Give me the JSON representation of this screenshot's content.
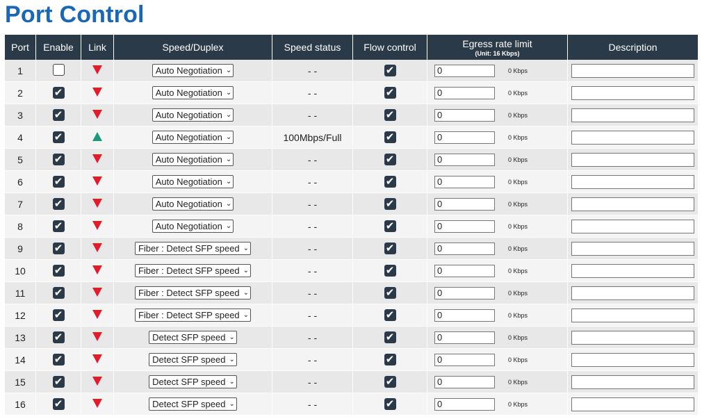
{
  "page": {
    "title": "Port Control"
  },
  "headers": {
    "port": "Port",
    "enable": "Enable",
    "link": "Link",
    "speed_duplex": "Speed/Duplex",
    "speed_status": "Speed status",
    "flow_control": "Flow control",
    "egress": "Egress rate limit",
    "egress_unit": "(Unit: 16 Kbps)",
    "description": "Description"
  },
  "rows": [
    {
      "port": "1",
      "enable": false,
      "link": "down",
      "speed": "Auto Negotiation",
      "status": "- -",
      "flow": true,
      "egress": "0",
      "unit": "0 Kbps",
      "desc": ""
    },
    {
      "port": "2",
      "enable": true,
      "link": "down",
      "speed": "Auto Negotiation",
      "status": "- -",
      "flow": true,
      "egress": "0",
      "unit": "0 Kbps",
      "desc": ""
    },
    {
      "port": "3",
      "enable": true,
      "link": "down",
      "speed": "Auto Negotiation",
      "status": "- -",
      "flow": true,
      "egress": "0",
      "unit": "0 Kbps",
      "desc": ""
    },
    {
      "port": "4",
      "enable": true,
      "link": "up",
      "speed": "Auto Negotiation",
      "status": "100Mbps/Full",
      "flow": true,
      "egress": "0",
      "unit": "0 Kbps",
      "desc": ""
    },
    {
      "port": "5",
      "enable": true,
      "link": "down",
      "speed": "Auto Negotiation",
      "status": "- -",
      "flow": true,
      "egress": "0",
      "unit": "0 Kbps",
      "desc": ""
    },
    {
      "port": "6",
      "enable": true,
      "link": "down",
      "speed": "Auto Negotiation",
      "status": "- -",
      "flow": true,
      "egress": "0",
      "unit": "0 Kbps",
      "desc": ""
    },
    {
      "port": "7",
      "enable": true,
      "link": "down",
      "speed": "Auto Negotiation",
      "status": "- -",
      "flow": true,
      "egress": "0",
      "unit": "0 Kbps",
      "desc": ""
    },
    {
      "port": "8",
      "enable": true,
      "link": "down",
      "speed": "Auto Negotiation",
      "status": "- -",
      "flow": true,
      "egress": "0",
      "unit": "0 Kbps",
      "desc": ""
    },
    {
      "port": "9",
      "enable": true,
      "link": "down",
      "speed": "Fiber : Detect SFP speed",
      "status": "- -",
      "flow": true,
      "egress": "0",
      "unit": "0 Kbps",
      "desc": ""
    },
    {
      "port": "10",
      "enable": true,
      "link": "down",
      "speed": "Fiber : Detect SFP speed",
      "status": "- -",
      "flow": true,
      "egress": "0",
      "unit": "0 Kbps",
      "desc": ""
    },
    {
      "port": "11",
      "enable": true,
      "link": "down",
      "speed": "Fiber : Detect SFP speed",
      "status": "- -",
      "flow": true,
      "egress": "0",
      "unit": "0 Kbps",
      "desc": ""
    },
    {
      "port": "12",
      "enable": true,
      "link": "down",
      "speed": "Fiber : Detect SFP speed",
      "status": "- -",
      "flow": true,
      "egress": "0",
      "unit": "0 Kbps",
      "desc": ""
    },
    {
      "port": "13",
      "enable": true,
      "link": "down",
      "speed": "Detect SFP speed",
      "status": "- -",
      "flow": true,
      "egress": "0",
      "unit": "0 Kbps",
      "desc": ""
    },
    {
      "port": "14",
      "enable": true,
      "link": "down",
      "speed": "Detect SFP speed",
      "status": "- -",
      "flow": true,
      "egress": "0",
      "unit": "0 Kbps",
      "desc": ""
    },
    {
      "port": "15",
      "enable": true,
      "link": "down",
      "speed": "Detect SFP speed",
      "status": "- -",
      "flow": true,
      "egress": "0",
      "unit": "0 Kbps",
      "desc": ""
    },
    {
      "port": "16",
      "enable": true,
      "link": "down",
      "speed": "Detect SFP speed",
      "status": "- -",
      "flow": true,
      "egress": "0",
      "unit": "0 Kbps",
      "desc": ""
    }
  ],
  "colors": {
    "title": "#1a67b5",
    "header_bg": "#2b3a48",
    "link_down": "#e01e2a",
    "link_up": "#1a9a7a"
  },
  "icons": {
    "checked": "checkbox-checked-icon",
    "unchecked": "checkbox-unchecked-icon",
    "link_down": "link-down-triangle-icon",
    "link_up": "link-up-triangle-icon",
    "select": "chevron-down-icon"
  }
}
